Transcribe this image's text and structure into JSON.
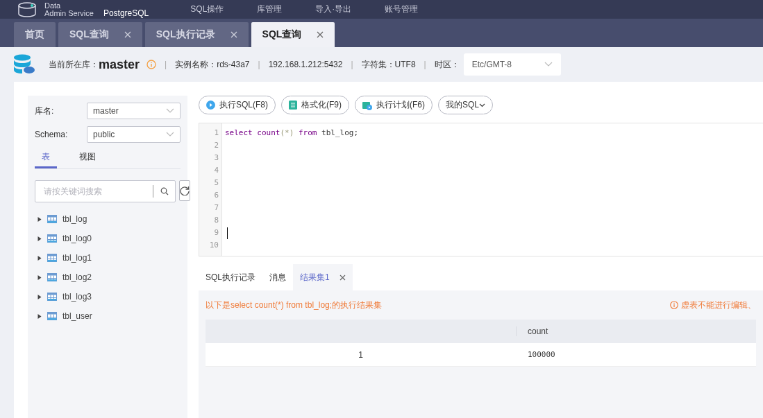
{
  "header": {
    "logo_line_1": "Data",
    "logo_line_2": "Admin Service",
    "product": "PostgreSQL",
    "nav": [
      "SQL操作",
      "库管理",
      "导入·导出",
      "账号管理"
    ]
  },
  "tabs": [
    {
      "label": "首页",
      "closable": false,
      "selected": false
    },
    {
      "label": "SQL查询",
      "closable": true,
      "selected": false
    },
    {
      "label": "SQL执行记录",
      "closable": true,
      "selected": false
    },
    {
      "label": "SQL查询",
      "closable": true,
      "selected": true
    }
  ],
  "info_bar": {
    "db_label": "当前所在库：",
    "db_name": "master",
    "instance": "实例名称：rds-43a7",
    "address": "192.168.1.212:5432",
    "charset": "字符集：UTF8",
    "timezone_label": "时区：",
    "timezone": "Etc/GMT-8",
    "separator": "|"
  },
  "sidebar": {
    "db_field": {
      "label": "库名:",
      "value": "master"
    },
    "schema_field": {
      "label": "Schema:",
      "value": "public"
    },
    "tabs": [
      {
        "label": "表",
        "selected": true
      },
      {
        "label": "视图",
        "selected": false
      }
    ],
    "search": {
      "placeholder": "请按关键词搜索"
    },
    "tables": [
      {
        "name": "tbl_log",
        "expanded": false
      },
      {
        "name": "tbl_log0",
        "expanded": false
      },
      {
        "name": "tbl_log1",
        "expanded": false
      },
      {
        "name": "tbl_log2",
        "expanded": false
      },
      {
        "name": "tbl_log3",
        "expanded": false
      },
      {
        "name": "tbl_user",
        "expanded": false
      }
    ]
  },
  "toolbar": [
    {
      "label": "执行SQL(F8)",
      "kind": "run"
    },
    {
      "label": "格式化(F9)",
      "kind": "format"
    },
    {
      "label": "执行计划(F6)",
      "kind": "plan"
    },
    {
      "label": "我的SQL",
      "kind": "dropdown"
    }
  ],
  "editor": {
    "lines": [
      "1",
      "2",
      "3",
      "4",
      "5",
      "6",
      "7",
      "8",
      "9",
      "10"
    ],
    "code": [
      {
        "text": "select",
        "kind": "keyword"
      },
      {
        "text": " count",
        "kind": "keyword"
      },
      {
        "text": "(*)",
        "kind": "paren"
      },
      {
        "text": " from",
        "kind": "keyword"
      },
      {
        "text": " tbl_log;",
        "kind": "plain"
      }
    ]
  },
  "result_tabs": [
    {
      "label": "SQL执行记录",
      "closable": false,
      "selected": false
    },
    {
      "label": "消息",
      "closable": false,
      "selected": false
    },
    {
      "label": "结果集1",
      "closable": true,
      "selected": true
    }
  ],
  "result": {
    "message": "以下是select count(*) from tbl_log;的执行结果集",
    "warning": "虚表不能进行编辑、",
    "columns": [
      "count"
    ],
    "rows": [
      {
        "index": "1",
        "cells": [
          "100000"
        ]
      }
    ]
  }
}
